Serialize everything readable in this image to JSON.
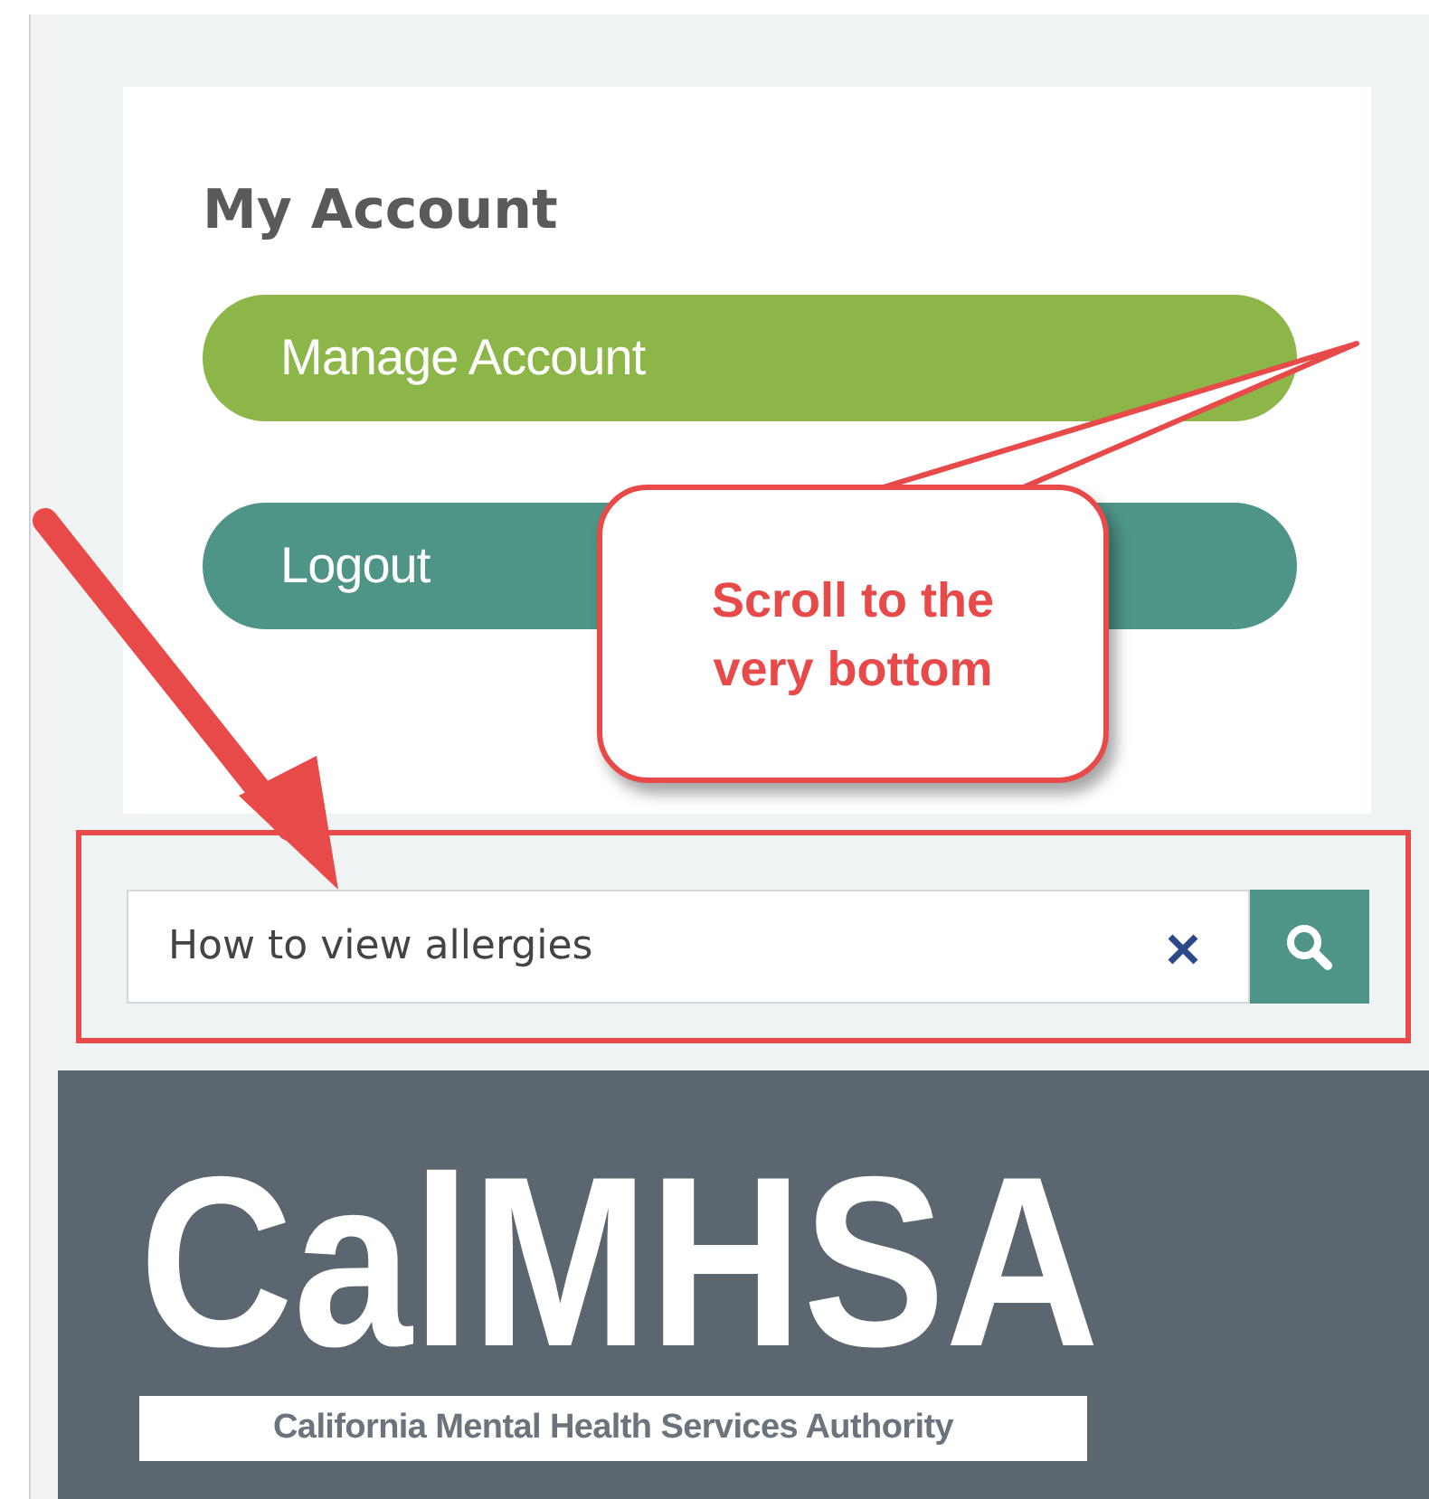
{
  "account": {
    "title": "My Account",
    "buttons": [
      {
        "label": "Manage Account",
        "kind": "primary"
      },
      {
        "label": "Logout",
        "kind": "secondary"
      }
    ]
  },
  "search": {
    "value": "How to view allergies"
  },
  "footer": {
    "logo": "CalMHSA",
    "tagline": "California Mental Health Services Authority"
  },
  "annotation": {
    "callout": "Scroll to the very bottom"
  }
}
